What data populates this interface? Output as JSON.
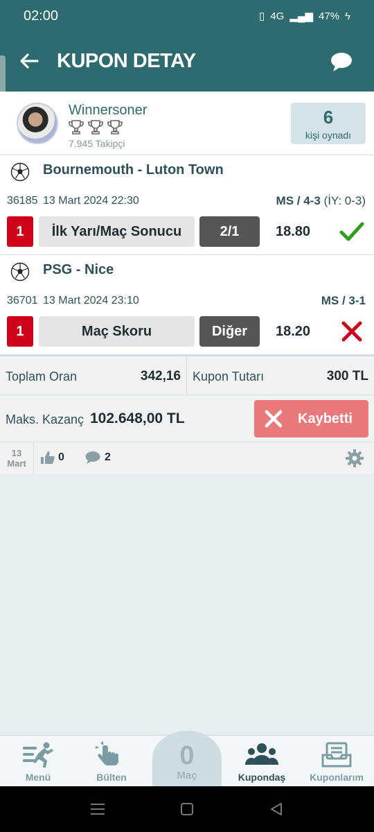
{
  "status": {
    "time": "02:00",
    "battery": "47%",
    "network": "4G"
  },
  "appbar": {
    "title": "KUPON DETAY"
  },
  "user": {
    "name": "Winnersoner",
    "followers": "7.945 Takipçi",
    "played_count": "6",
    "played_label": "kişi oynadı",
    "trophies": 3
  },
  "matches": [
    {
      "title": "Bournemouth - Luton Town",
      "code": "36185",
      "date": "13 Mart 2024 22:30",
      "score_main": "MS / 4-3",
      "score_half": "(İY: 0-3)",
      "mbs": "1",
      "bet": "İlk Yarı/Maç Sonucu",
      "pick": "2/1",
      "odd": "18.80",
      "result": "won"
    },
    {
      "title": "PSG - Nice",
      "code": "36701",
      "date": "13 Mart 2024 23:10",
      "score_main": "MS / 3-1",
      "score_half": "",
      "mbs": "1",
      "bet": "Maç Skoru",
      "pick": "Diğer",
      "odd": "18.20",
      "result": "lost"
    }
  ],
  "totals": {
    "total_odds_label": "Toplam Oran",
    "total_odds": "342,16",
    "stake_label": "Kupon Tutarı",
    "stake": "300 TL"
  },
  "gain": {
    "label": "Maks. Kazanç",
    "value": "102.648,00 TL",
    "status": "Kaybetti"
  },
  "footer": {
    "day": "13",
    "month": "Mart",
    "likes": "0",
    "comments": "2"
  },
  "nav": {
    "menu": "Menü",
    "bulten": "Bülten",
    "mac_count": "0",
    "mac": "Maç",
    "kupondas": "Kupondaş",
    "kuponlarim": "Kuponlarım"
  },
  "colors": {
    "header": "#2e6b70",
    "accent_red": "#d0021b",
    "won": "#2e9e1f",
    "lost": "#d0021b",
    "lost_badge": "#e9797b"
  }
}
